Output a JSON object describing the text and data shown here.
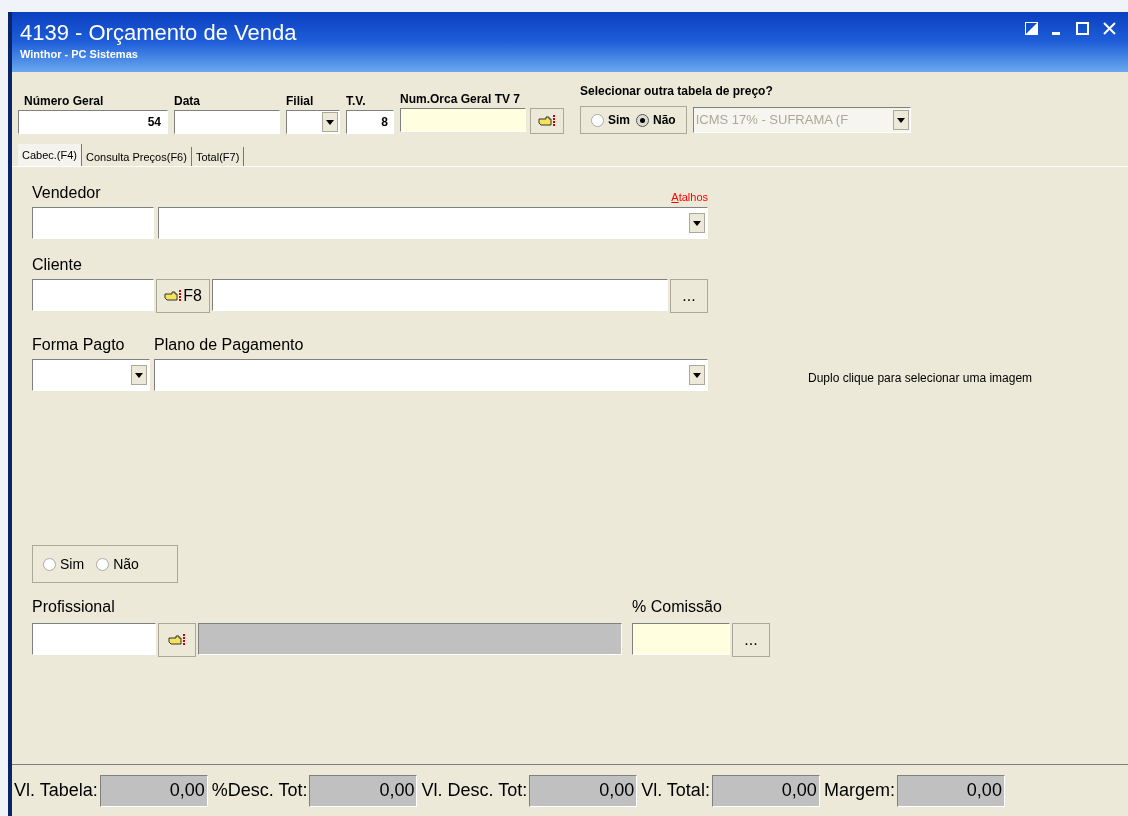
{
  "window": {
    "title": "4139 - Orçamento de Venda",
    "subtitle": "Winthor - PC Sistemas"
  },
  "header": {
    "numero_geral": {
      "label": "Número Geral",
      "value": "54"
    },
    "data": {
      "label": "Data"
    },
    "filial": {
      "label": "Filial"
    },
    "tv": {
      "label": "T.V.",
      "value": "8"
    },
    "num_orca": {
      "label": "Num.Orca Geral TV 7"
    },
    "price_table": {
      "question": "Selecionar outra tabela de preço?",
      "options": [
        {
          "label": "Sim",
          "selected": false
        },
        {
          "label": "Não",
          "selected": true
        }
      ],
      "select_value": "ICMS 17% - SUFRAMA (F",
      "disabled": true
    }
  },
  "tabs": [
    {
      "label": "Cabec.(F4)",
      "selected": true
    },
    {
      "label": "Consulta Preços(F6)",
      "selected": false
    },
    {
      "label": "Total(F7)",
      "selected": false
    }
  ],
  "form": {
    "vendedor": {
      "label": "Vendedor"
    },
    "atalhos": "Atalhos",
    "cliente": {
      "label": "Cliente",
      "f8": "F8",
      "more": "..."
    },
    "forma_pagto": {
      "label": "Forma Pagto"
    },
    "plano": {
      "label": "Plano de Pagamento"
    },
    "image_hint": "Duplo clique para selecionar uma imagem",
    "radios": [
      {
        "label": "Sim",
        "selected": false
      },
      {
        "label": "Não",
        "selected": false
      }
    ],
    "profissional": {
      "label": "Profissional"
    },
    "comissao": {
      "label": "% Comissão",
      "more": "..."
    }
  },
  "totals": [
    {
      "label": "Vl. Tabela:",
      "value": "0,00"
    },
    {
      "label": "%Desc. Tot:",
      "value": "0,00"
    },
    {
      "label": "Vl. Desc. Tot:",
      "value": "0,00"
    },
    {
      "label": "Vl. Total:",
      "value": "0,00"
    },
    {
      "label": "Margem:",
      "value": "0,00"
    }
  ]
}
